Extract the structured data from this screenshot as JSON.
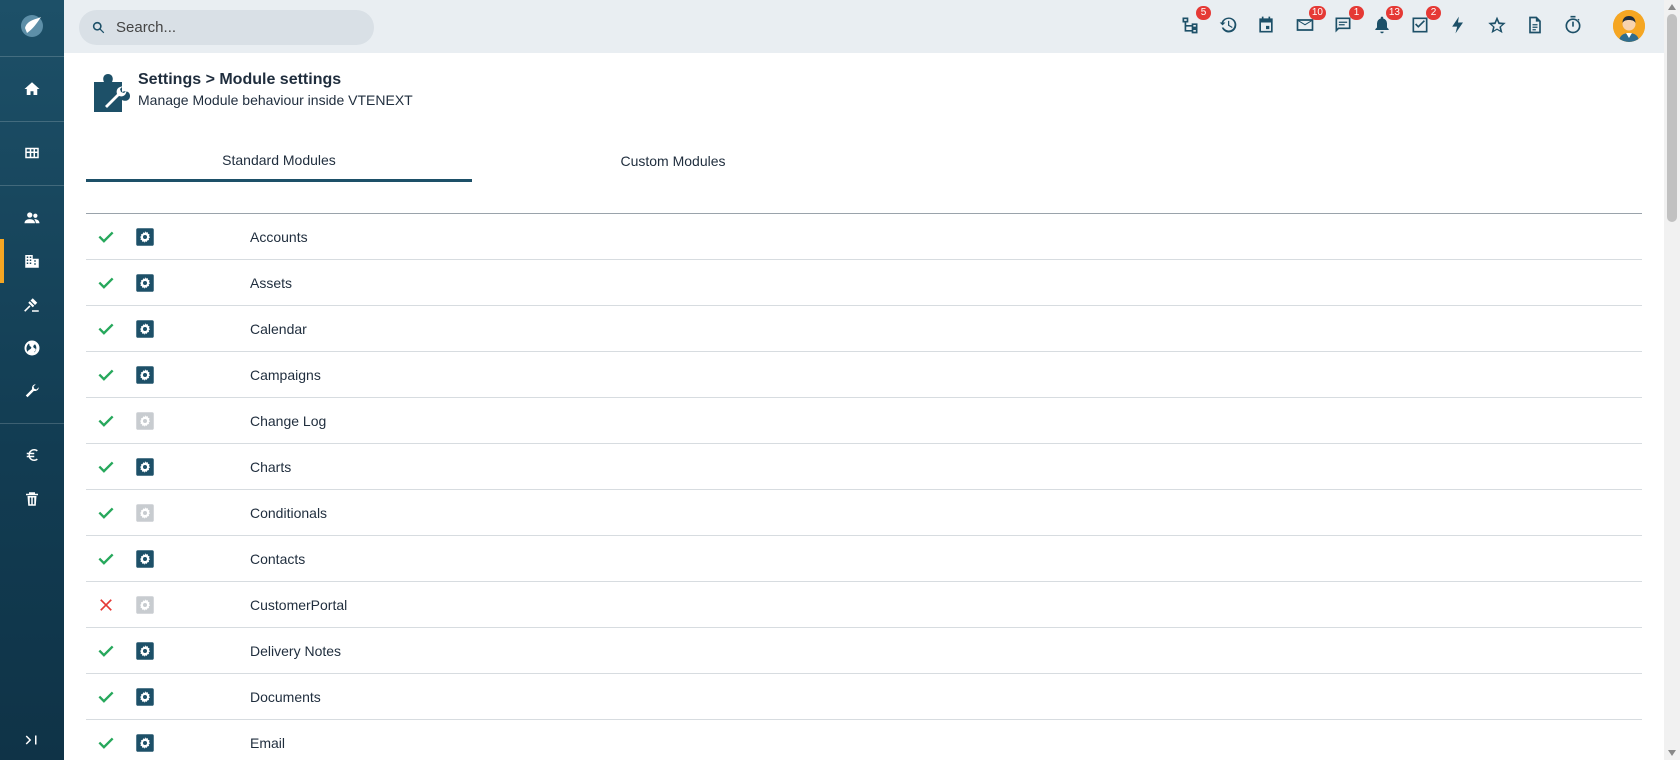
{
  "search": {
    "placeholder": "Search..."
  },
  "topbar": {
    "badges": {
      "processes": "5",
      "messages": "10",
      "talks": "1",
      "notifications": "13",
      "tasks": "2"
    }
  },
  "header": {
    "title": "Settings > Module settings",
    "subtitle": "Manage Module behaviour inside VTENEXT"
  },
  "tabs": [
    {
      "label": "Standard Modules",
      "active": true
    },
    {
      "label": "Custom Modules",
      "active": false
    }
  ],
  "colors": {
    "brand": "#1d5068",
    "accent": "#f5a623",
    "enabled": "#27a85c",
    "disabled": "#e53935",
    "gear_inactive": "#c8ccd0"
  },
  "modules": [
    {
      "name": "Accounts",
      "enabled": true,
      "configurable": true
    },
    {
      "name": "Assets",
      "enabled": true,
      "configurable": true
    },
    {
      "name": "Calendar",
      "enabled": true,
      "configurable": true
    },
    {
      "name": "Campaigns",
      "enabled": true,
      "configurable": true
    },
    {
      "name": "Change Log",
      "enabled": true,
      "configurable": false
    },
    {
      "name": "Charts",
      "enabled": true,
      "configurable": true
    },
    {
      "name": "Conditionals",
      "enabled": true,
      "configurable": false
    },
    {
      "name": "Contacts",
      "enabled": true,
      "configurable": true
    },
    {
      "name": "CustomerPortal",
      "enabled": false,
      "configurable": false
    },
    {
      "name": "Delivery Notes",
      "enabled": true,
      "configurable": true
    },
    {
      "name": "Documents",
      "enabled": true,
      "configurable": true
    },
    {
      "name": "Email",
      "enabled": true,
      "configurable": true
    }
  ]
}
